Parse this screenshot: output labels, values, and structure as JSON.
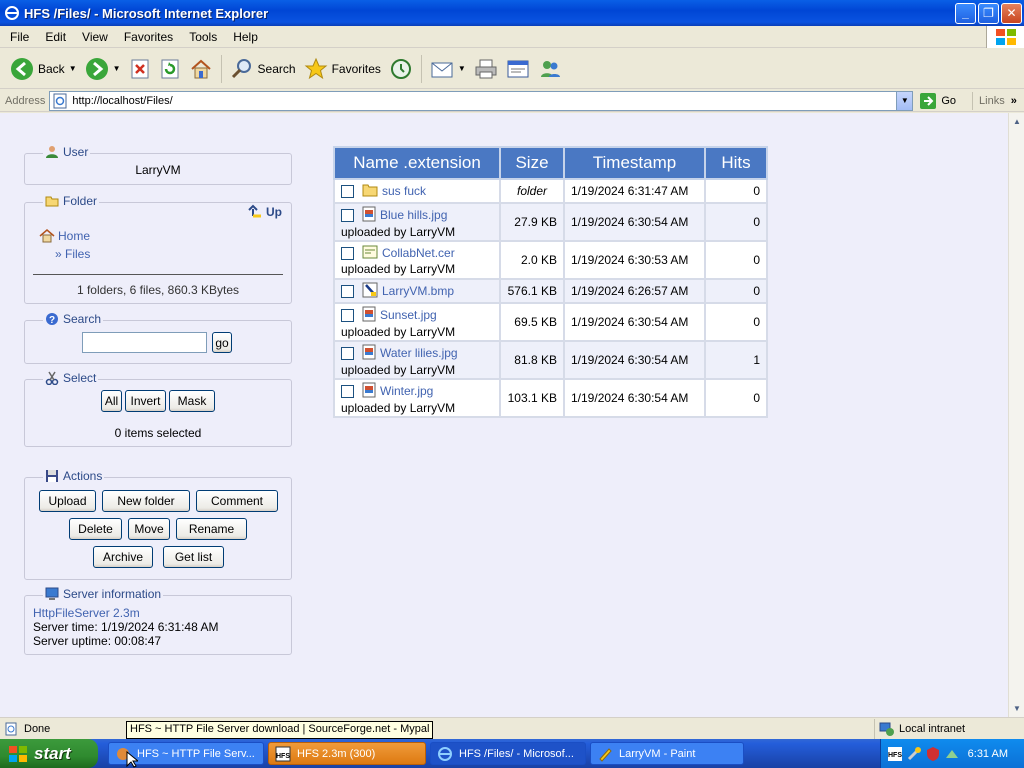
{
  "window": {
    "title": "HFS /Files/ - Microsoft Internet Explorer"
  },
  "menu": [
    "File",
    "Edit",
    "View",
    "Favorites",
    "Tools",
    "Help"
  ],
  "toolbar": {
    "back": "Back",
    "search": "Search",
    "favorites": "Favorites"
  },
  "address": {
    "label": "Address",
    "url": "http://localhost/Files/",
    "go": "Go",
    "links": "Links"
  },
  "user_panel": {
    "legend": "User",
    "name": "LarryVM"
  },
  "folder_panel": {
    "legend": "Folder",
    "up": "Up",
    "home": "Home",
    "current": "» Files",
    "summary": "1 folders, 6 files, 860.3 KBytes"
  },
  "search_panel": {
    "legend": "Search",
    "placeholder": "",
    "go": "go"
  },
  "select_panel": {
    "legend": "Select",
    "all": "All",
    "invert": "Invert",
    "mask": "Mask",
    "status": "0 items selected"
  },
  "actions_panel": {
    "legend": "Actions",
    "upload": "Upload",
    "new_folder": "New folder",
    "comment": "Comment",
    "delete": "Delete",
    "move": "Move",
    "rename": "Rename",
    "archive": "Archive",
    "get_list": "Get list"
  },
  "server_panel": {
    "legend": "Server information",
    "version": "HttpFileServer 2.3m",
    "time": "Server time: 1/19/2024 6:31:48 AM",
    "uptime": "Server uptime: 00:08:47"
  },
  "table": {
    "headers": [
      "Name .extension",
      "Size",
      "Timestamp",
      "Hits"
    ],
    "rows": [
      {
        "name": "sus fuck",
        "sub": "",
        "size": "folder",
        "timestamp": "1/19/2024 6:31:47 AM",
        "hits": "0",
        "icon": "folder-icon"
      },
      {
        "name": "Blue hills.jpg",
        "sub": "uploaded by LarryVM",
        "size": "27.9 KB",
        "timestamp": "1/19/2024 6:30:54 AM",
        "hits": "0",
        "icon": "image-file-icon"
      },
      {
        "name": "CollabNet.cer",
        "sub": "uploaded by LarryVM",
        "size": "2.0 KB",
        "timestamp": "1/19/2024 6:30:53 AM",
        "hits": "0",
        "icon": "certificate-icon"
      },
      {
        "name": "LarryVM.bmp",
        "sub": "",
        "size": "576.1 KB",
        "timestamp": "1/19/2024 6:26:57 AM",
        "hits": "0",
        "icon": "bitmap-file-icon"
      },
      {
        "name": "Sunset.jpg",
        "sub": "uploaded by LarryVM",
        "size": "69.5 KB",
        "timestamp": "1/19/2024 6:30:54 AM",
        "hits": "0",
        "icon": "image-file-icon"
      },
      {
        "name": "Water lilies.jpg",
        "sub": "uploaded by LarryVM",
        "size": "81.8 KB",
        "timestamp": "1/19/2024 6:30:54 AM",
        "hits": "1",
        "icon": "image-file-icon"
      },
      {
        "name": "Winter.jpg",
        "sub": "uploaded by LarryVM",
        "size": "103.1 KB",
        "timestamp": "1/19/2024 6:30:54 AM",
        "hits": "0",
        "icon": "image-file-icon"
      }
    ]
  },
  "status": {
    "text": "Done",
    "zone": "Local intranet",
    "tooltip": "HFS ~ HTTP File Server download | SourceForge.net - Mypal"
  },
  "taskbar": {
    "start": "start",
    "tasks": [
      "HFS ~ HTTP File Serv...",
      "HFS 2.3m (300)",
      "HFS /Files/ - Microsof...",
      "LarryVM - Paint"
    ],
    "clock": "6:31 AM"
  }
}
